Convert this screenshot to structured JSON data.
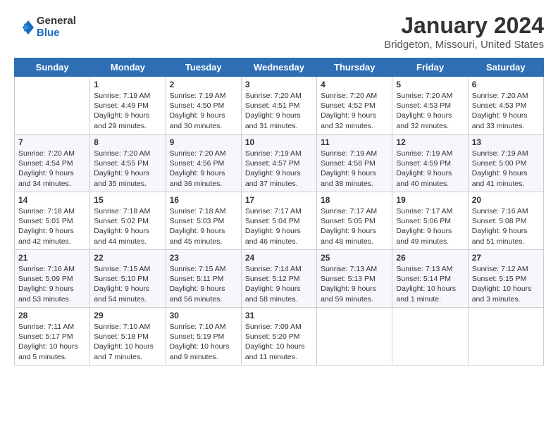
{
  "logo": {
    "general": "General",
    "blue": "Blue"
  },
  "title": "January 2024",
  "subtitle": "Bridgeton, Missouri, United States",
  "headers": [
    "Sunday",
    "Monday",
    "Tuesday",
    "Wednesday",
    "Thursday",
    "Friday",
    "Saturday"
  ],
  "weeks": [
    [
      {
        "day": "",
        "lines": []
      },
      {
        "day": "1",
        "lines": [
          "Sunrise: 7:19 AM",
          "Sunset: 4:49 PM",
          "Daylight: 9 hours",
          "and 29 minutes."
        ]
      },
      {
        "day": "2",
        "lines": [
          "Sunrise: 7:19 AM",
          "Sunset: 4:50 PM",
          "Daylight: 9 hours",
          "and 30 minutes."
        ]
      },
      {
        "day": "3",
        "lines": [
          "Sunrise: 7:20 AM",
          "Sunset: 4:51 PM",
          "Daylight: 9 hours",
          "and 31 minutes."
        ]
      },
      {
        "day": "4",
        "lines": [
          "Sunrise: 7:20 AM",
          "Sunset: 4:52 PM",
          "Daylight: 9 hours",
          "and 32 minutes."
        ]
      },
      {
        "day": "5",
        "lines": [
          "Sunrise: 7:20 AM",
          "Sunset: 4:53 PM",
          "Daylight: 9 hours",
          "and 32 minutes."
        ]
      },
      {
        "day": "6",
        "lines": [
          "Sunrise: 7:20 AM",
          "Sunset: 4:53 PM",
          "Daylight: 9 hours",
          "and 33 minutes."
        ]
      }
    ],
    [
      {
        "day": "7",
        "lines": [
          "Sunrise: 7:20 AM",
          "Sunset: 4:54 PM",
          "Daylight: 9 hours",
          "and 34 minutes."
        ]
      },
      {
        "day": "8",
        "lines": [
          "Sunrise: 7:20 AM",
          "Sunset: 4:55 PM",
          "Daylight: 9 hours",
          "and 35 minutes."
        ]
      },
      {
        "day": "9",
        "lines": [
          "Sunrise: 7:20 AM",
          "Sunset: 4:56 PM",
          "Daylight: 9 hours",
          "and 36 minutes."
        ]
      },
      {
        "day": "10",
        "lines": [
          "Sunrise: 7:19 AM",
          "Sunset: 4:57 PM",
          "Daylight: 9 hours",
          "and 37 minutes."
        ]
      },
      {
        "day": "11",
        "lines": [
          "Sunrise: 7:19 AM",
          "Sunset: 4:58 PM",
          "Daylight: 9 hours",
          "and 38 minutes."
        ]
      },
      {
        "day": "12",
        "lines": [
          "Sunrise: 7:19 AM",
          "Sunset: 4:59 PM",
          "Daylight: 9 hours",
          "and 40 minutes."
        ]
      },
      {
        "day": "13",
        "lines": [
          "Sunrise: 7:19 AM",
          "Sunset: 5:00 PM",
          "Daylight: 9 hours",
          "and 41 minutes."
        ]
      }
    ],
    [
      {
        "day": "14",
        "lines": [
          "Sunrise: 7:18 AM",
          "Sunset: 5:01 PM",
          "Daylight: 9 hours",
          "and 42 minutes."
        ]
      },
      {
        "day": "15",
        "lines": [
          "Sunrise: 7:18 AM",
          "Sunset: 5:02 PM",
          "Daylight: 9 hours",
          "and 44 minutes."
        ]
      },
      {
        "day": "16",
        "lines": [
          "Sunrise: 7:18 AM",
          "Sunset: 5:03 PM",
          "Daylight: 9 hours",
          "and 45 minutes."
        ]
      },
      {
        "day": "17",
        "lines": [
          "Sunrise: 7:17 AM",
          "Sunset: 5:04 PM",
          "Daylight: 9 hours",
          "and 46 minutes."
        ]
      },
      {
        "day": "18",
        "lines": [
          "Sunrise: 7:17 AM",
          "Sunset: 5:05 PM",
          "Daylight: 9 hours",
          "and 48 minutes."
        ]
      },
      {
        "day": "19",
        "lines": [
          "Sunrise: 7:17 AM",
          "Sunset: 5:06 PM",
          "Daylight: 9 hours",
          "and 49 minutes."
        ]
      },
      {
        "day": "20",
        "lines": [
          "Sunrise: 7:16 AM",
          "Sunset: 5:08 PM",
          "Daylight: 9 hours",
          "and 51 minutes."
        ]
      }
    ],
    [
      {
        "day": "21",
        "lines": [
          "Sunrise: 7:16 AM",
          "Sunset: 5:09 PM",
          "Daylight: 9 hours",
          "and 53 minutes."
        ]
      },
      {
        "day": "22",
        "lines": [
          "Sunrise: 7:15 AM",
          "Sunset: 5:10 PM",
          "Daylight: 9 hours",
          "and 54 minutes."
        ]
      },
      {
        "day": "23",
        "lines": [
          "Sunrise: 7:15 AM",
          "Sunset: 5:11 PM",
          "Daylight: 9 hours",
          "and 56 minutes."
        ]
      },
      {
        "day": "24",
        "lines": [
          "Sunrise: 7:14 AM",
          "Sunset: 5:12 PM",
          "Daylight: 9 hours",
          "and 58 minutes."
        ]
      },
      {
        "day": "25",
        "lines": [
          "Sunrise: 7:13 AM",
          "Sunset: 5:13 PM",
          "Daylight: 9 hours",
          "and 59 minutes."
        ]
      },
      {
        "day": "26",
        "lines": [
          "Sunrise: 7:13 AM",
          "Sunset: 5:14 PM",
          "Daylight: 10 hours",
          "and 1 minute."
        ]
      },
      {
        "day": "27",
        "lines": [
          "Sunrise: 7:12 AM",
          "Sunset: 5:15 PM",
          "Daylight: 10 hours",
          "and 3 minutes."
        ]
      }
    ],
    [
      {
        "day": "28",
        "lines": [
          "Sunrise: 7:11 AM",
          "Sunset: 5:17 PM",
          "Daylight: 10 hours",
          "and 5 minutes."
        ]
      },
      {
        "day": "29",
        "lines": [
          "Sunrise: 7:10 AM",
          "Sunset: 5:18 PM",
          "Daylight: 10 hours",
          "and 7 minutes."
        ]
      },
      {
        "day": "30",
        "lines": [
          "Sunrise: 7:10 AM",
          "Sunset: 5:19 PM",
          "Daylight: 10 hours",
          "and 9 minutes."
        ]
      },
      {
        "day": "31",
        "lines": [
          "Sunrise: 7:09 AM",
          "Sunset: 5:20 PM",
          "Daylight: 10 hours",
          "and 11 minutes."
        ]
      },
      {
        "day": "",
        "lines": []
      },
      {
        "day": "",
        "lines": []
      },
      {
        "day": "",
        "lines": []
      }
    ]
  ]
}
